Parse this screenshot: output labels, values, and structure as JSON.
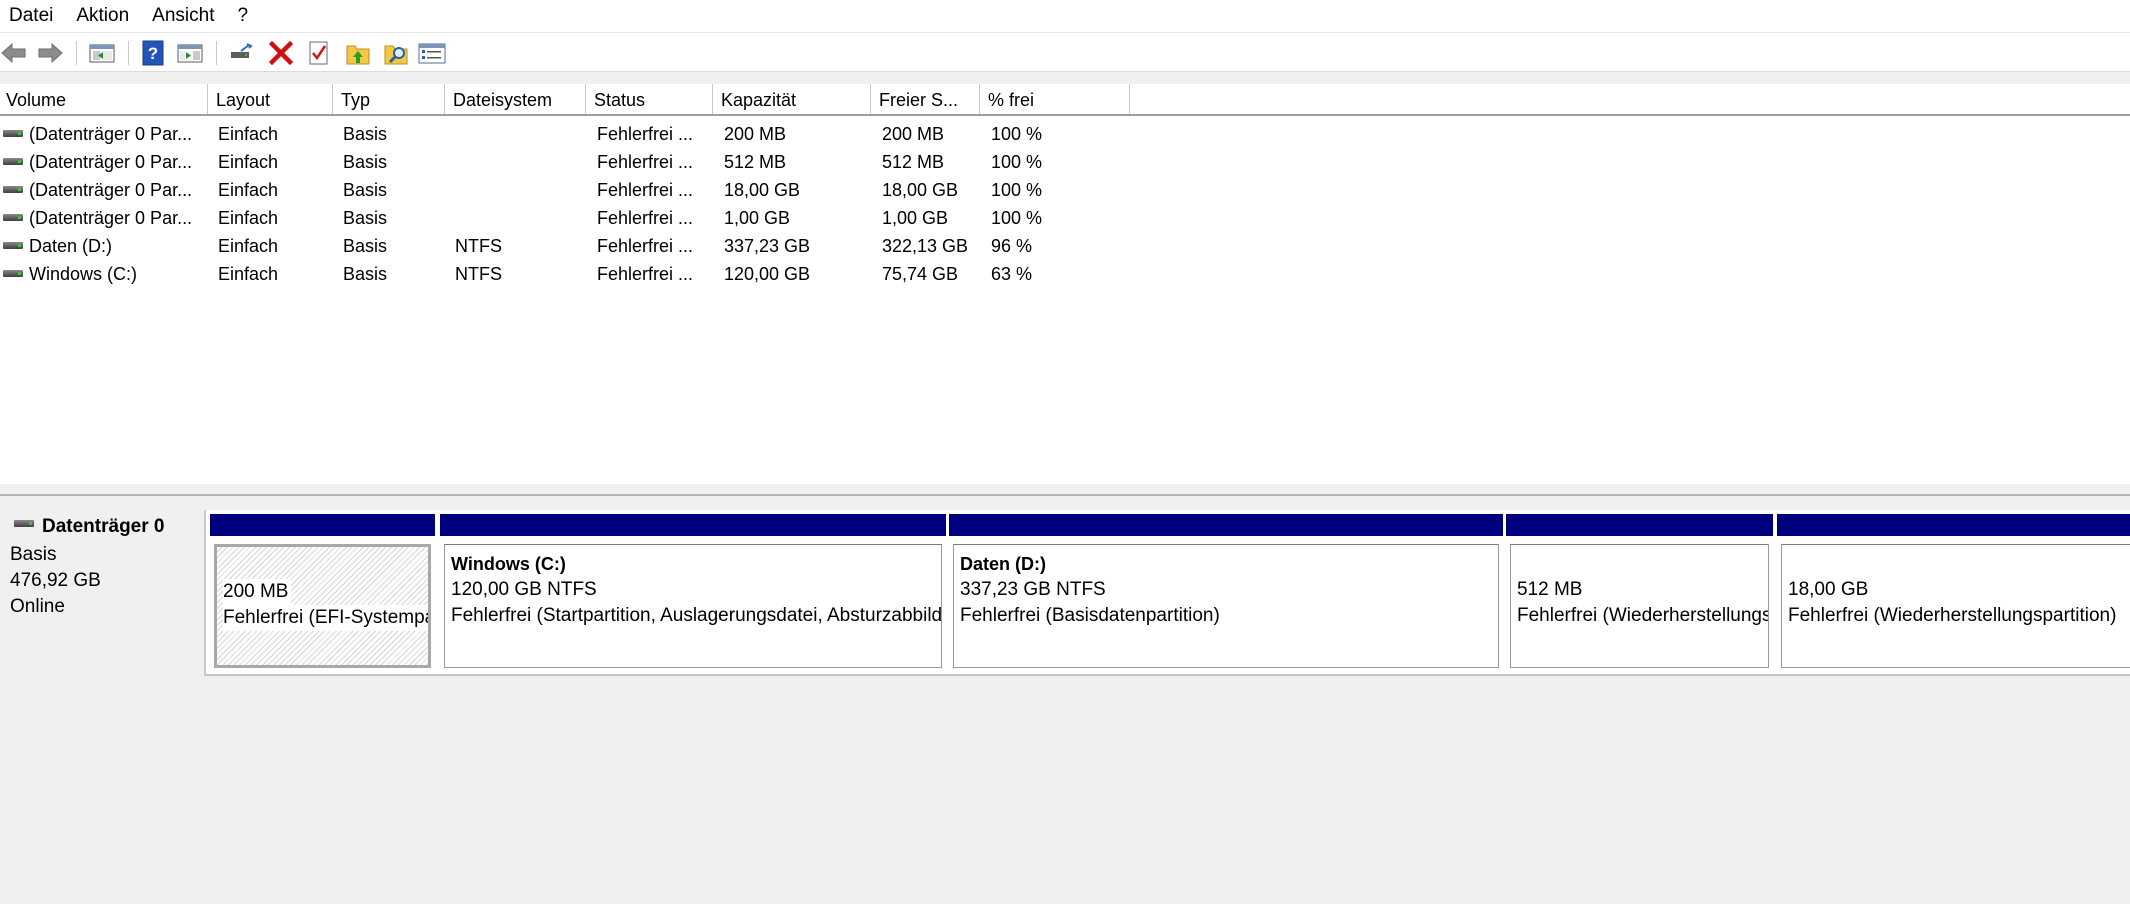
{
  "menu": {
    "items": [
      "Datei",
      "Aktion",
      "Ansicht",
      "?"
    ]
  },
  "toolbar": {
    "buttons": [
      "back-icon",
      "forward-icon",
      "console-tree-icon",
      "help-icon",
      "action-pane-icon",
      "connect-disk-icon",
      "delete-icon",
      "properties-icon",
      "up-icon",
      "find-icon",
      "checklist-icon"
    ]
  },
  "volume_list": {
    "columns": [
      "Volume",
      "Layout",
      "Typ",
      "Dateisystem",
      "Status",
      "Kapazität",
      "Freier S...",
      "% frei"
    ],
    "rows": [
      {
        "volume": "(Datenträger 0 Par...",
        "layout": "Einfach",
        "typ": "Basis",
        "dateisystem": "",
        "status": "Fehlerfrei ...",
        "kapazitaet": "200 MB",
        "frei": "200 MB",
        "prozent": "100 %"
      },
      {
        "volume": "(Datenträger 0 Par...",
        "layout": "Einfach",
        "typ": "Basis",
        "dateisystem": "",
        "status": "Fehlerfrei ...",
        "kapazitaet": "512 MB",
        "frei": "512 MB",
        "prozent": "100 %"
      },
      {
        "volume": "(Datenträger 0 Par...",
        "layout": "Einfach",
        "typ": "Basis",
        "dateisystem": "",
        "status": "Fehlerfrei ...",
        "kapazitaet": "18,00 GB",
        "frei": "18,00 GB",
        "prozent": "100 %"
      },
      {
        "volume": "(Datenträger 0 Par...",
        "layout": "Einfach",
        "typ": "Basis",
        "dateisystem": "",
        "status": "Fehlerfrei ...",
        "kapazitaet": "1,00 GB",
        "frei": "1,00 GB",
        "prozent": "100 %"
      },
      {
        "volume": "Daten (D:)",
        "layout": "Einfach",
        "typ": "Basis",
        "dateisystem": "NTFS",
        "status": "Fehlerfrei ...",
        "kapazitaet": "337,23 GB",
        "frei": "322,13 GB",
        "prozent": "96 %"
      },
      {
        "volume": "Windows (C:)",
        "layout": "Einfach",
        "typ": "Basis",
        "dateisystem": "NTFS",
        "status": "Fehlerfrei ...",
        "kapazitaet": "120,00 GB",
        "frei": "75,74 GB",
        "prozent": "63 %"
      }
    ]
  },
  "disk": {
    "name": "Datenträger 0",
    "type": "Basis",
    "size": "476,92 GB",
    "state": "Online",
    "partitions": [
      {
        "title": "",
        "size": "200 MB",
        "status": "Fehlerfrei (EFI-Systempartition)"
      },
      {
        "title": "Windows  (C:)",
        "size": "120,00 GB NTFS",
        "status": "Fehlerfrei (Startpartition, Auslagerungsdatei, Absturzabbild, Primäre Partition)"
      },
      {
        "title": "Daten  (D:)",
        "size": "337,23 GB NTFS",
        "status": "Fehlerfrei (Basisdatenpartition)"
      },
      {
        "title": "",
        "size": "512 MB",
        "status": "Fehlerfrei (Wiederherstellungspartition)"
      },
      {
        "title": "",
        "size": "18,00 GB",
        "status": "Fehlerfrei (Wiederherstellungspartition)"
      }
    ]
  },
  "colors": {
    "partition_bar": "#00007e",
    "window_bg": "#f0f0f0",
    "delete_red": "#d01010"
  }
}
